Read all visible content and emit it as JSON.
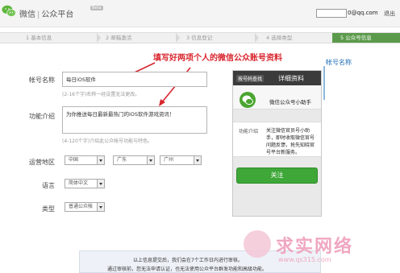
{
  "header": {
    "brand": "微信",
    "separator": "|",
    "platform": "公众平台",
    "beta": "Beta",
    "account_suffix": "0@qq.com",
    "logout": "退出"
  },
  "steps": [
    {
      "label": "1 基本信息"
    },
    {
      "label": "2 邮箱激活"
    },
    {
      "label": "3 信息登记"
    },
    {
      "label": "4 选择类型"
    },
    {
      "label": "5 公众号信息"
    }
  ],
  "annotations": {
    "main": "填写好两项个人的微信公众账号资料",
    "account_name_hint": "帐号名称"
  },
  "form": {
    "account_name_label": "帐号名称",
    "account_name_value": "每日iOS软件",
    "account_name_hint": "(2-16个字)名称一经设置无法更改。",
    "intro_label": "功能介绍",
    "intro_value": "为你推送每日最新最热门的iOS软件游戏资讯！",
    "intro_hint": "(4-120个字)介绍此公众帐号功能与特色。",
    "region_label": "运营地区",
    "country": "中国",
    "province": "广东",
    "city": "广州",
    "language_label": "语言",
    "language": "简体中文",
    "type_label": "类型",
    "type": "普通公众帐"
  },
  "preview": {
    "search_tag": "按号码查找",
    "title": "详细资料",
    "account_name": "微信公众号小助手",
    "intro_label": "功能介绍",
    "intro_text": "关注微信官员号小助手，即时收取微信官号问题反馈，抢先知晓官号平台新服务。",
    "follow_button": "关注"
  },
  "notice": {
    "line1": "以上信息提交后，我们会在7个工作日内进行审核。",
    "line2": "通过审核前，您无法申请认证，也无法使用公众平台群发功能和高级功能。"
  },
  "watermark": {
    "text": "求实网络",
    "url": "www.qs315.com"
  },
  "colors": {
    "active_step": "#5b9a4b",
    "follow": "#3ea737",
    "annotation_red": "#d8262e",
    "annotation_blue": "#1f6fb8"
  }
}
